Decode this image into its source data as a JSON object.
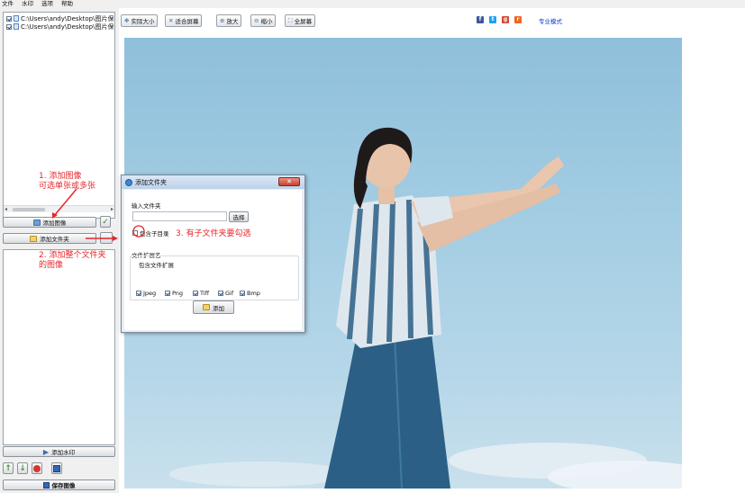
{
  "menu": [
    "文件",
    "水印",
    "选项",
    "帮助"
  ],
  "file_list": [
    {
      "path": "C:\\Users\\andy\\Desktop\\图片保存",
      "checked": true
    },
    {
      "path": "C:\\Users\\andy\\Desktop\\图片保存",
      "checked": true
    }
  ],
  "left_buttons": {
    "add_image": "添加图像",
    "add_folder": "添加文件夹",
    "add_watermark": "添加水印",
    "save_image": "保存图像"
  },
  "toolbar": {
    "actual_size": "实际大小",
    "fit_screen": "适合屏幕",
    "zoom_in": "放大",
    "zoom_out": "缩小",
    "fullscreen": "全屏幕",
    "pro_mode": "专业模式"
  },
  "social_icons": [
    "facebook-icon",
    "twitter-icon",
    "google-plus-icon",
    "rss-icon"
  ],
  "dialog": {
    "title": "添加文件夹",
    "close": "✕",
    "input_label": "输入文件夹",
    "input_value": "",
    "browse": "选择",
    "include_subdirs": "包含子目录",
    "include_subdirs_checked": false,
    "ext_group_label": "文件扩展名",
    "ext_sub_label": "包含文件扩展",
    "extensions": [
      {
        "label": "Jpeg",
        "checked": true
      },
      {
        "label": "Png",
        "checked": true
      },
      {
        "label": "Tiff",
        "checked": true
      },
      {
        "label": "Gif",
        "checked": true
      },
      {
        "label": "Bmp",
        "checked": true
      }
    ],
    "add_button": "添加"
  },
  "annotations": {
    "a1_line1": "1. 添加图像",
    "a1_line2": "可选单张或多张",
    "a2_line1": "2. 添加整个文件夹",
    "a2_line2": "的图像",
    "a3": "3. 有子文件夹要勾选"
  },
  "colors": {
    "annotation": "#e8262a",
    "pro_link": "#0a3cc8"
  }
}
